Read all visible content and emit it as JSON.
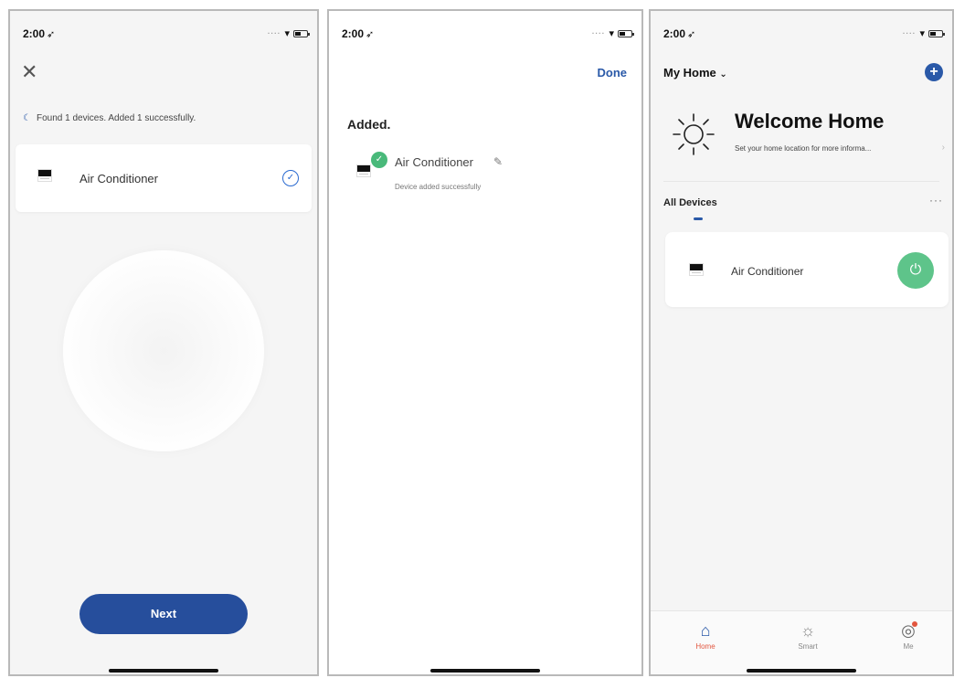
{
  "status_bar": {
    "time": "2:00",
    "location_glyph": "➶"
  },
  "screen1": {
    "found_message": "Found 1 devices. Added 1 successfully.",
    "device_name": "Air Conditioner",
    "next_label": "Next"
  },
  "screen2": {
    "done_label": "Done",
    "added_title": "Added.",
    "device_name": "Air Conditioner",
    "device_subtitle": "Device added successfully"
  },
  "screen3": {
    "home_selector": "My Home",
    "welcome_title": "Welcome Home",
    "welcome_subtitle": "Set your home location for more informa...",
    "section_title": "All Devices",
    "device_name": "Air Conditioner",
    "tabs": [
      {
        "label": "Home",
        "icon": "home-icon"
      },
      {
        "label": "Smart",
        "icon": "smart-icon"
      },
      {
        "label": "Me",
        "icon": "profile-icon"
      }
    ]
  },
  "colors": {
    "primary": "#264e9c",
    "success": "#49b97a",
    "power": "#5ec48a",
    "accent_red": "#e2563f"
  }
}
